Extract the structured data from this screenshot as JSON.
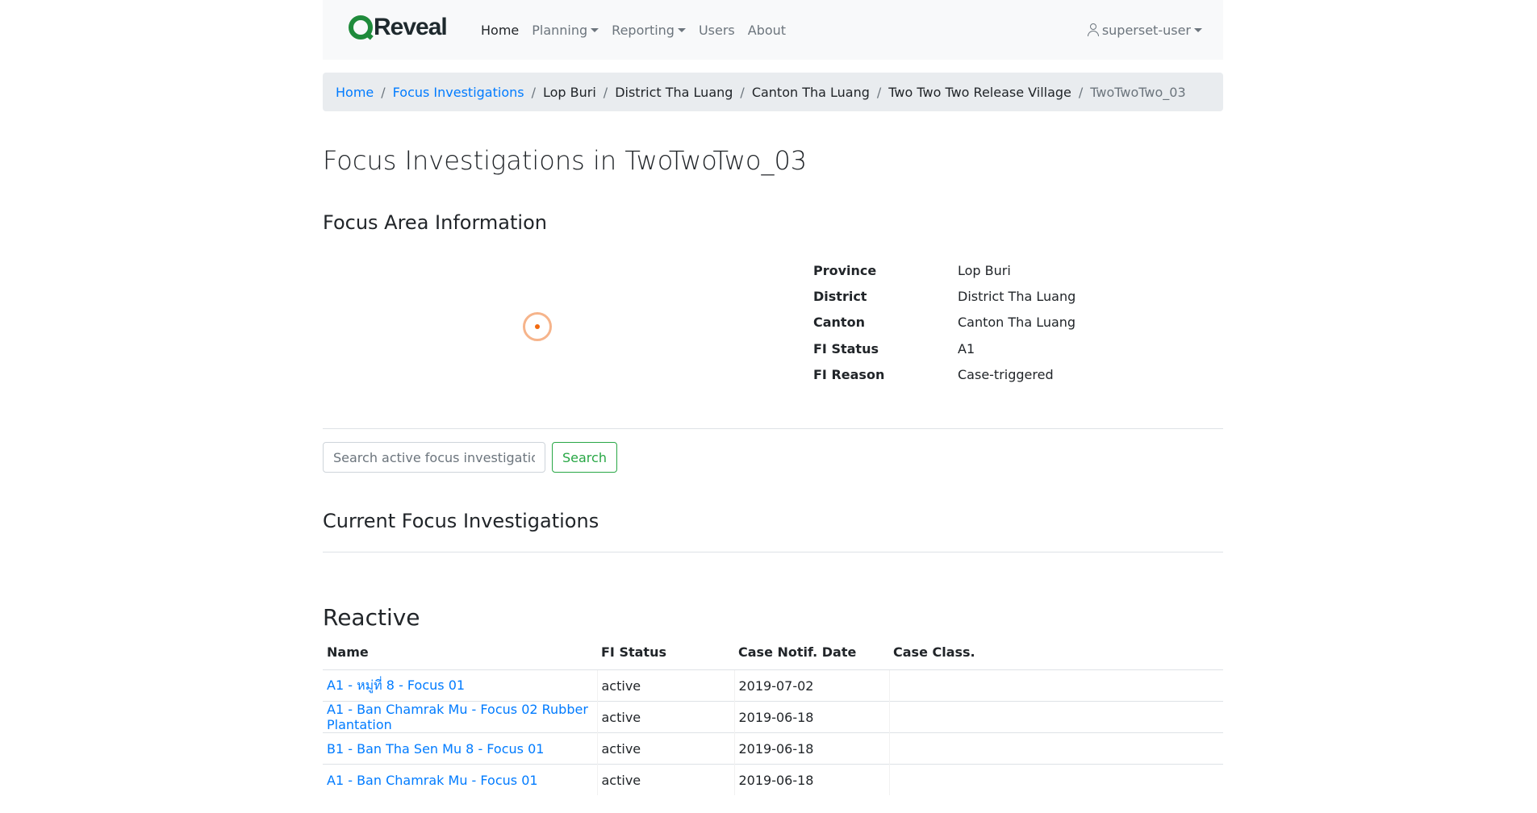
{
  "navbar": {
    "brand": "Reveal",
    "links": [
      {
        "label": "Home",
        "active": true,
        "dropdown": false
      },
      {
        "label": "Planning",
        "active": false,
        "dropdown": true
      },
      {
        "label": "Reporting",
        "active": false,
        "dropdown": true
      },
      {
        "label": "Users",
        "active": false,
        "dropdown": false
      },
      {
        "label": "About",
        "active": false,
        "dropdown": false
      }
    ],
    "user": "superset-user"
  },
  "breadcrumb": {
    "home": "Home",
    "focus_investigations": "Focus Investigations",
    "province": "Lop Buri",
    "district": "District Tha Luang",
    "canton": "Canton Tha Luang",
    "village": "Two Two Two Release Village",
    "current": "TwoTwoTwo_03"
  },
  "page_title": "Focus Investigations in TwoTwoTwo_03",
  "focus_area": {
    "title": "Focus Area Information",
    "rows": [
      {
        "label": "Province",
        "value": "Lop Buri"
      },
      {
        "label": "District",
        "value": "District Tha Luang"
      },
      {
        "label": "Canton",
        "value": "Canton Tha Luang"
      },
      {
        "label": "FI Status",
        "value": "A1"
      },
      {
        "label": "FI Reason",
        "value": "Case-triggered"
      }
    ]
  },
  "search": {
    "placeholder": "Search active focus investigations",
    "button": "Search"
  },
  "current_title": "Current Focus Investigations",
  "reactive": {
    "title": "Reactive",
    "columns": [
      "Name",
      "FI Status",
      "Case Notif. Date",
      "Case Class."
    ],
    "rows": [
      {
        "name": "A1 - หมู่ที่ 8 - Focus 01",
        "status": "active",
        "date": "2019-07-02",
        "case_class": ""
      },
      {
        "name": "A1 - Ban Chamrak Mu - Focus 02 Rubber Plantation",
        "status": "active",
        "date": "2019-06-18",
        "case_class": ""
      },
      {
        "name": "B1 - Ban Tha Sen Mu 8 - Focus 01",
        "status": "active",
        "date": "2019-06-18",
        "case_class": ""
      },
      {
        "name": "A1 - Ban Chamrak Mu - Focus 01",
        "status": "active",
        "date": "2019-06-18",
        "case_class": ""
      }
    ]
  },
  "colors": {
    "link": "#007bff",
    "brand_green": "#1f8b3b",
    "search_button": "#28a745",
    "marker": "#f26a10"
  }
}
